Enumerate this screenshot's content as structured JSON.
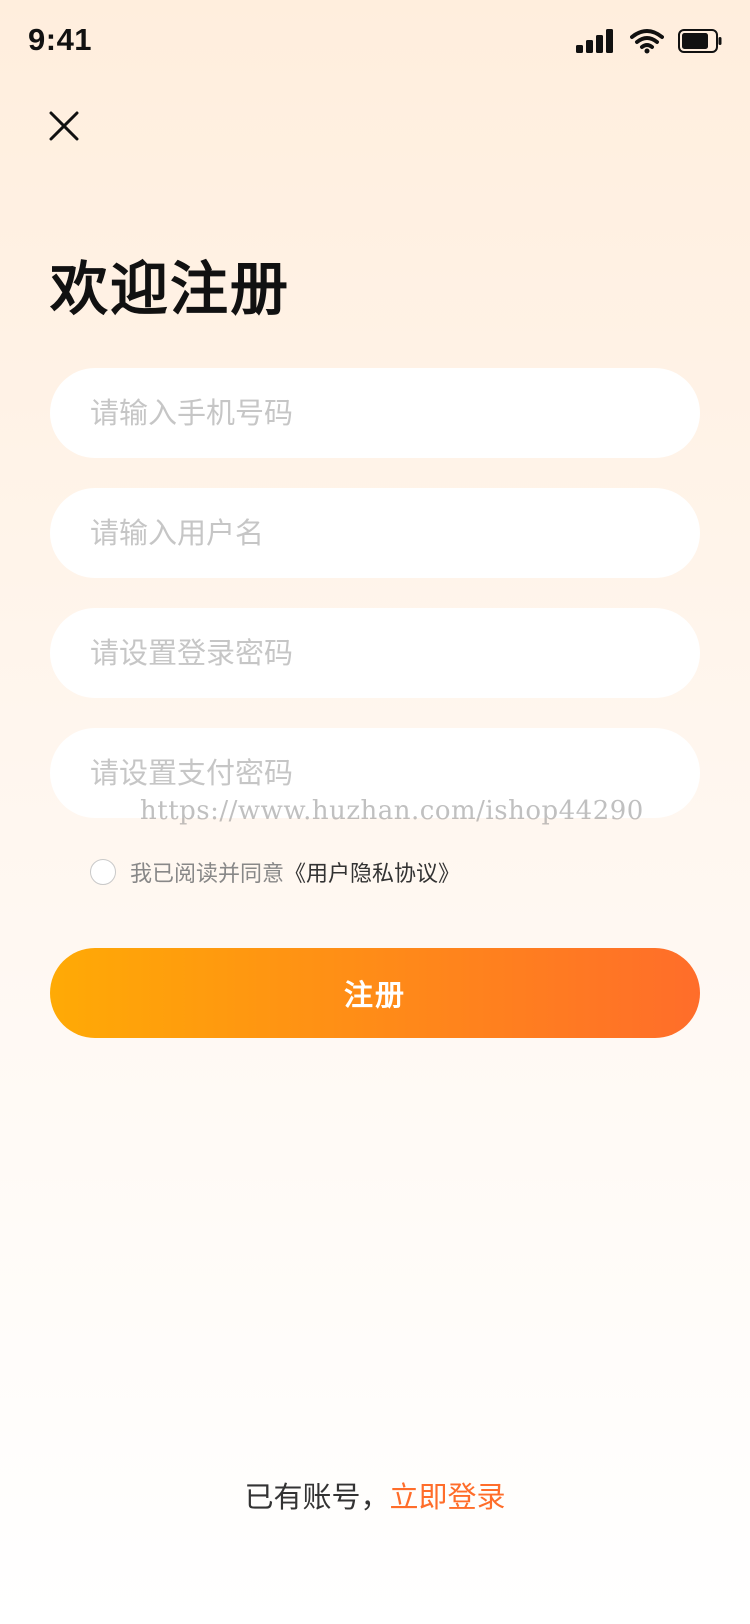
{
  "status_bar": {
    "time": "9:41",
    "icons": [
      "signal-icon",
      "wifi-icon",
      "battery-icon"
    ]
  },
  "close_icon": "close-icon",
  "page_title": "欢迎注册",
  "form": {
    "phone_placeholder": "请输入手机号码",
    "username_placeholder": "请输入用户名",
    "login_password_placeholder": "请设置登录密码",
    "pay_password_placeholder": "请设置支付密码"
  },
  "watermark": "https://www.huzhan.com/ishop44290",
  "agreement": {
    "prefix": "我已阅读并同意",
    "link": "《用户隐私协议》",
    "checked": false
  },
  "register_button": "注册",
  "footer": {
    "prefix": "已有账号，",
    "login_link": "立即登录"
  },
  "colors": {
    "accent_start": "#FFAA05",
    "accent_end": "#FF6D2A",
    "link": "#FF6D2A",
    "placeholder": "#C6C6C6"
  }
}
